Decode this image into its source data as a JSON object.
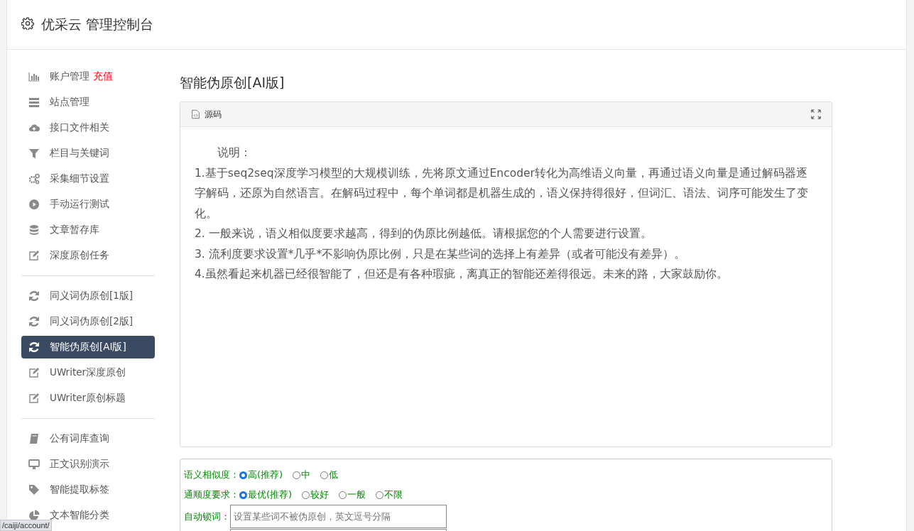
{
  "header": {
    "title": "优采云 管理控制台"
  },
  "sidebar": {
    "groups": [
      {
        "items": [
          {
            "kind": "chart",
            "label": "账户管理",
            "badge": "充值",
            "selected": false
          },
          {
            "kind": "server",
            "label": "站点管理",
            "selected": false
          },
          {
            "kind": "cloud",
            "label": "接口文件相关",
            "selected": false
          },
          {
            "kind": "filter",
            "label": "栏目与关键词",
            "selected": false
          },
          {
            "kind": "gears",
            "label": "采集细节设置",
            "selected": false
          },
          {
            "kind": "play",
            "label": "手动运行测试",
            "selected": false
          },
          {
            "kind": "database",
            "label": "文章暂存库",
            "selected": false
          },
          {
            "kind": "edit",
            "label": "深度原创任务",
            "selected": false
          }
        ]
      },
      {
        "items": [
          {
            "kind": "refresh",
            "label": "同义词伪原创[1版]",
            "selected": false
          },
          {
            "kind": "refresh",
            "label": "同义词伪原创[2版]",
            "selected": false
          },
          {
            "kind": "refresh",
            "label": "智能伪原创[AI版]",
            "selected": true
          },
          {
            "kind": "edit",
            "label": "UWriter深度原创",
            "selected": false
          },
          {
            "kind": "edit",
            "label": "UWriter原创标题",
            "selected": false
          }
        ]
      },
      {
        "items": [
          {
            "kind": "book",
            "label": "公有词库查询",
            "selected": false
          },
          {
            "kind": "monitor",
            "label": "正文识别演示",
            "selected": false
          },
          {
            "kind": "tag",
            "label": "智能提取标签",
            "selected": false
          },
          {
            "kind": "pie",
            "label": "文本智能分类",
            "selected": false
          }
        ]
      }
    ]
  },
  "content": {
    "title": "智能伪原创[AI版]",
    "editor": {
      "tab": "源码",
      "paragraphs": [
        "说明：",
        "1.基于seq2seq深度学习模型的大规模训练，先将原文通过Encoder转化为高维语义向量，再通过语义向量是通过解码器逐字解码，还原为自然语言。在解码过程中，每个单词都是机器生成的，语义保持得很好，但词汇、语法、词序可能发生了变化。",
        "2. 一般来说，语义相似度要求越高，得到的伪原比例越低。请根据您的个人需要进行设置。",
        "3. 流利度要求设置*几乎*不影响伪原比例，只是在某些词的选择上有差异（或者可能没有差异）。",
        "4.虽然看起来机器已经很智能了，但还是有各种瑕疵，离真正的智能还差得很远。未来的路，大家鼓励你。"
      ]
    },
    "options": [
      {
        "label": "语义相似度：",
        "choices": [
          {
            "label": "高(推荐)",
            "selected": true
          },
          {
            "label": "中",
            "selected": false
          },
          {
            "label": "低",
            "selected": false
          }
        ]
      },
      {
        "label": "通顺度要求：",
        "choices": [
          {
            "label": "最优(推荐)",
            "selected": true
          },
          {
            "label": "较好",
            "selected": false
          },
          {
            "label": "一般",
            "selected": false
          },
          {
            "label": "不限",
            "selected": false
          }
        ]
      }
    ],
    "lock_words": {
      "label": "自动锁词：",
      "placeholder": "设置某些词不被伪原创，英文逗号分隔"
    }
  },
  "status_url": "/caiji/account/"
}
